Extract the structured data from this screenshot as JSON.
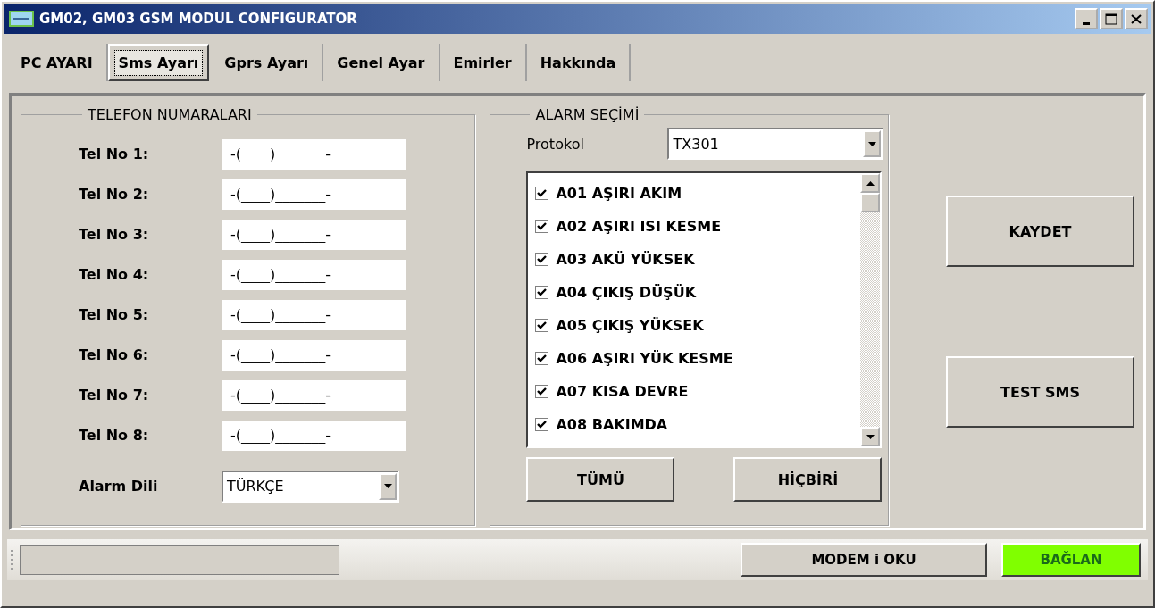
{
  "window": {
    "title": "GM02, GM03 GSM MODUL CONFIGURATOR"
  },
  "tabs": [
    {
      "label": "PC AYARI",
      "selected": false
    },
    {
      "label": "Sms Ayarı",
      "selected": true
    },
    {
      "label": "Gprs Ayarı",
      "selected": false
    },
    {
      "label": "Genel Ayar",
      "selected": false
    },
    {
      "label": "Emirler",
      "selected": false
    },
    {
      "label": "Hakkında",
      "selected": false
    }
  ],
  "phone_group": {
    "title": "TELEFON NUMARALARI",
    "phones": [
      {
        "label": "Tel No 1:",
        "value": "-(____)_______-"
      },
      {
        "label": "Tel No 2:",
        "value": "-(____)_______-"
      },
      {
        "label": "Tel No 3:",
        "value": "-(____)_______-"
      },
      {
        "label": "Tel No 4:",
        "value": "-(____)_______-"
      },
      {
        "label": "Tel No 5:",
        "value": "-(____)_______-"
      },
      {
        "label": "Tel No 6:",
        "value": "-(____)_______-"
      },
      {
        "label": "Tel No 7:",
        "value": "-(____)_______-"
      },
      {
        "label": "Tel No 8:",
        "value": "-(____)_______-"
      }
    ],
    "language": {
      "label": "Alarm Dili",
      "value": "TÜRKÇE"
    }
  },
  "alarm_group": {
    "title": "ALARM SEÇİMİ",
    "protocol": {
      "label": "Protokol",
      "value": "TX301"
    },
    "alarms": [
      {
        "label": "A01 AŞIRI AKIM",
        "checked": true
      },
      {
        "label": "A02 AŞIRI ISI KESME",
        "checked": true
      },
      {
        "label": "A03 AKÜ YÜKSEK",
        "checked": true
      },
      {
        "label": "A04 ÇIKIŞ DÜŞÜK",
        "checked": true
      },
      {
        "label": "A05 ÇIKIŞ YÜKSEK",
        "checked": true
      },
      {
        "label": "A06 AŞIRI YÜK KESME",
        "checked": true
      },
      {
        "label": "A07 KISA DEVRE",
        "checked": true
      },
      {
        "label": "A08 BAKIMDA",
        "checked": true
      }
    ],
    "buttons": [
      "TÜMÜ",
      "HİÇBİRİ"
    ]
  },
  "side_buttons": [
    "KAYDET",
    "TEST SMS"
  ],
  "status_bar": {
    "buttons": [
      {
        "label": "MODEM i OKU",
        "kind": "plain"
      },
      {
        "label": "BAĞLAN",
        "kind": "connect"
      }
    ]
  }
}
